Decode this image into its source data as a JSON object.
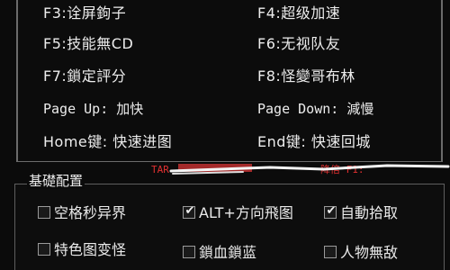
{
  "hotkeys": {
    "rows": [
      {
        "left": "F3:诠屏鉤子",
        "right": "F4:超级加速"
      },
      {
        "left": "F5:技能無CD",
        "right": "F6:无视队友"
      },
      {
        "left": "F7:鎖定評分",
        "right": "F8:怪變哥布林"
      },
      {
        "left": "Page Up: 加快",
        "right": "Page Down: 減慢"
      },
      {
        "left": "Home键: 快速进图",
        "right": "End键: 快速回城"
      }
    ]
  },
  "overlay": {
    "left_red": "TAR",
    "right_red": "降倍 F1:",
    "scribble_colors": {
      "line": "#ffffff",
      "text": "#e03030"
    }
  },
  "basic_settings": {
    "title": "基礎配置",
    "options": [
      {
        "label": "空格秒异界",
        "checked": false
      },
      {
        "label": "ALT+方向飛图",
        "checked": true
      },
      {
        "label": "自動拾取",
        "checked": true
      },
      {
        "label": "特色图变怪",
        "checked": false
      },
      {
        "label": "鎖血鎖蓝",
        "checked": false
      },
      {
        "label": "人物無敌",
        "checked": false
      }
    ]
  },
  "colors": {
    "background": "#0b0b0b",
    "text": "#ededed",
    "border": "#6b6b6b",
    "red": "#e03030"
  }
}
